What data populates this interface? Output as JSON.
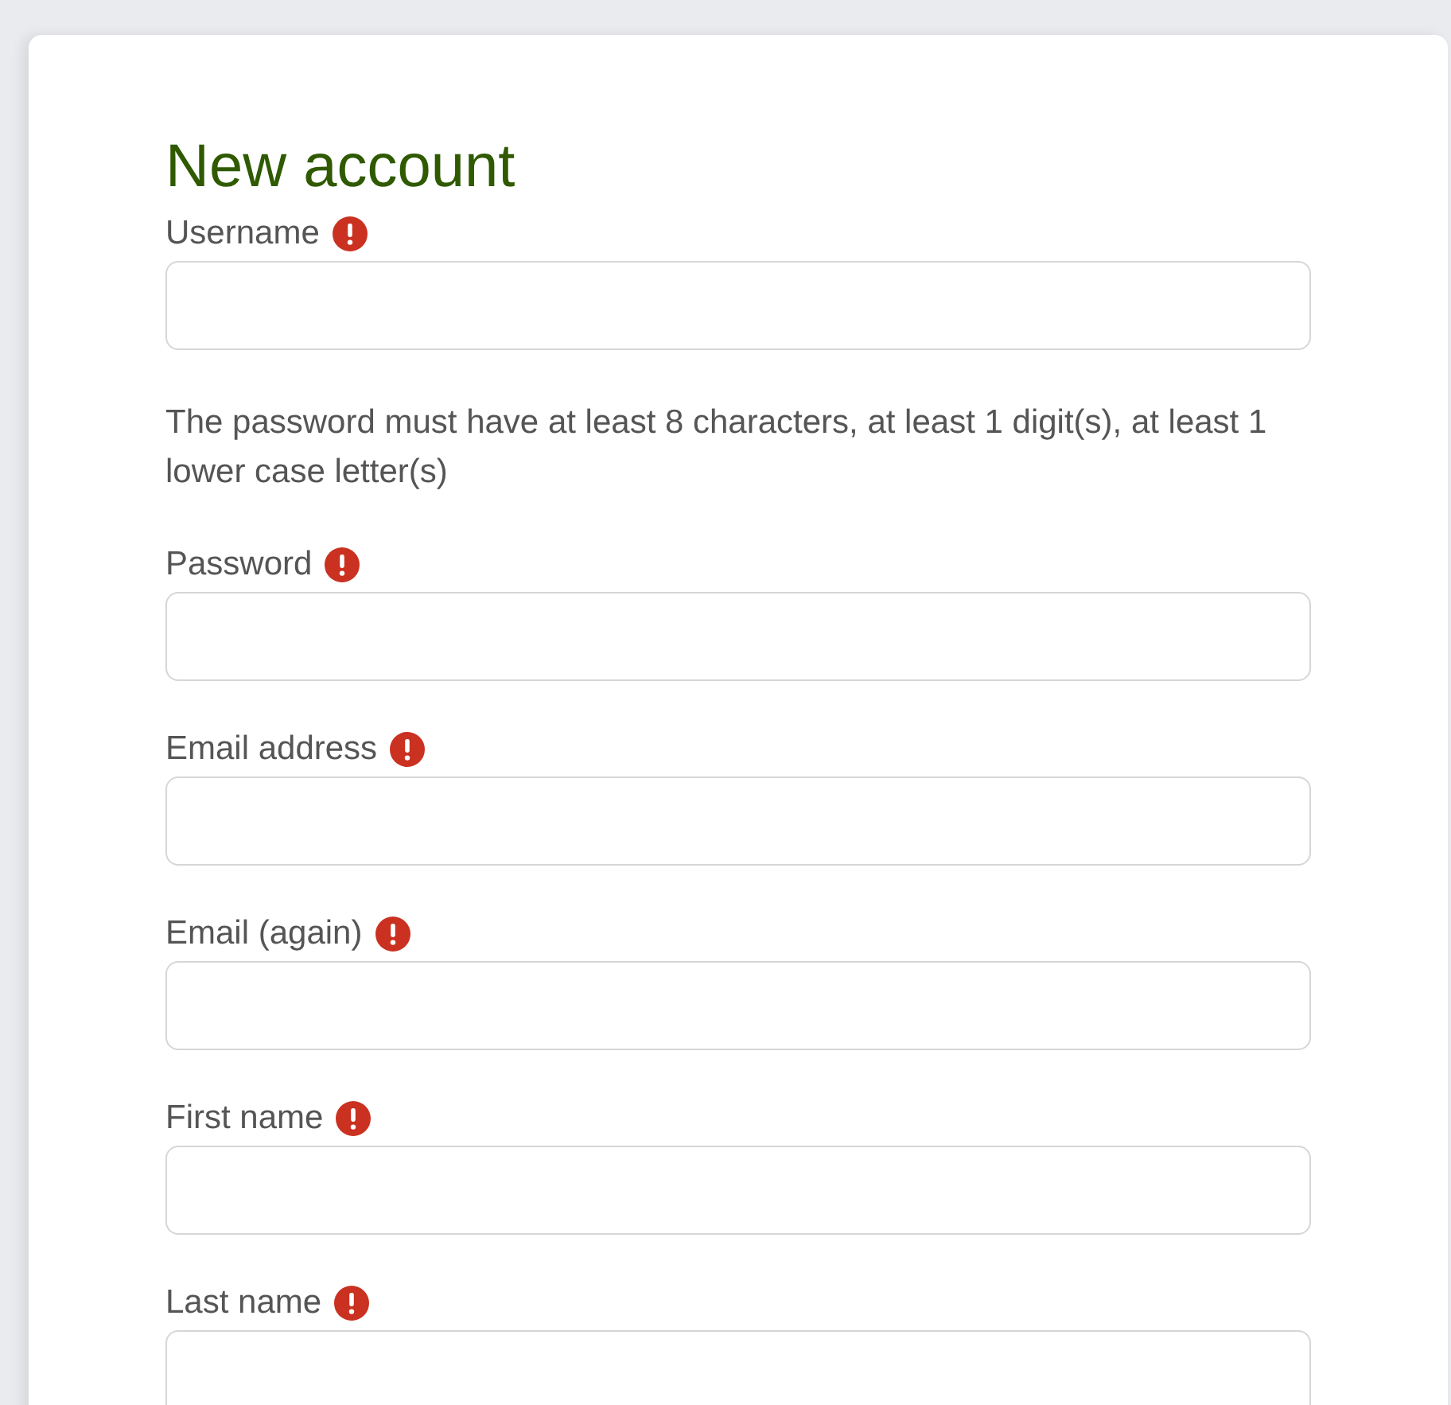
{
  "form": {
    "title": "New account",
    "items": [
      {
        "kind": "field",
        "label": "Username",
        "required": true
      },
      {
        "kind": "note",
        "text": "The password must have at least 8 characters, at least 1 digit(s), at least 1 lower case letter(s)"
      },
      {
        "kind": "field",
        "label": "Password",
        "required": true
      },
      {
        "kind": "field",
        "label": "Email address",
        "required": true
      },
      {
        "kind": "field",
        "label": "Email (again)",
        "required": true
      },
      {
        "kind": "field",
        "label": "First name",
        "required": true
      },
      {
        "kind": "field",
        "label": "Last name",
        "required": true
      }
    ]
  }
}
